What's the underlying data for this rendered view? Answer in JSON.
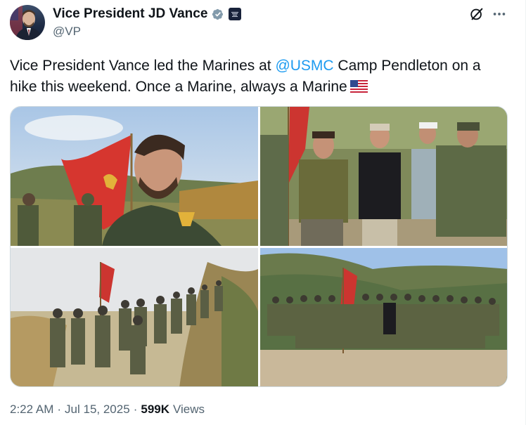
{
  "author": {
    "display_name": "Vice President JD Vance",
    "handle": "@VP",
    "badge_icon": "verified-badge-icon",
    "affiliation_icon": "white-house-seal-icon"
  },
  "tweet": {
    "text_before": "Vice President Vance led the Marines at ",
    "mention": "@USMC",
    "text_after": " Camp Pendleton on a hike this weekend. Once a Marine, always a Marine",
    "emoji_icon": "us-flag-icon"
  },
  "media": {
    "count": 4,
    "photos": [
      "photo-1",
      "photo-2",
      "photo-3",
      "photo-4"
    ]
  },
  "meta": {
    "time": "2:22 AM",
    "sep1": "·",
    "date": "Jul 15, 2025",
    "sep2": "·",
    "views_count": "599K",
    "views_label": "Views"
  },
  "actions": {
    "grok_icon": "grok-icon",
    "more_icon": "more-options-icon"
  },
  "colors": {
    "link": "#1d9bf0",
    "text": "#0f1419",
    "muted": "#536471",
    "verified": "#829aab",
    "border": "#cfd9de"
  }
}
